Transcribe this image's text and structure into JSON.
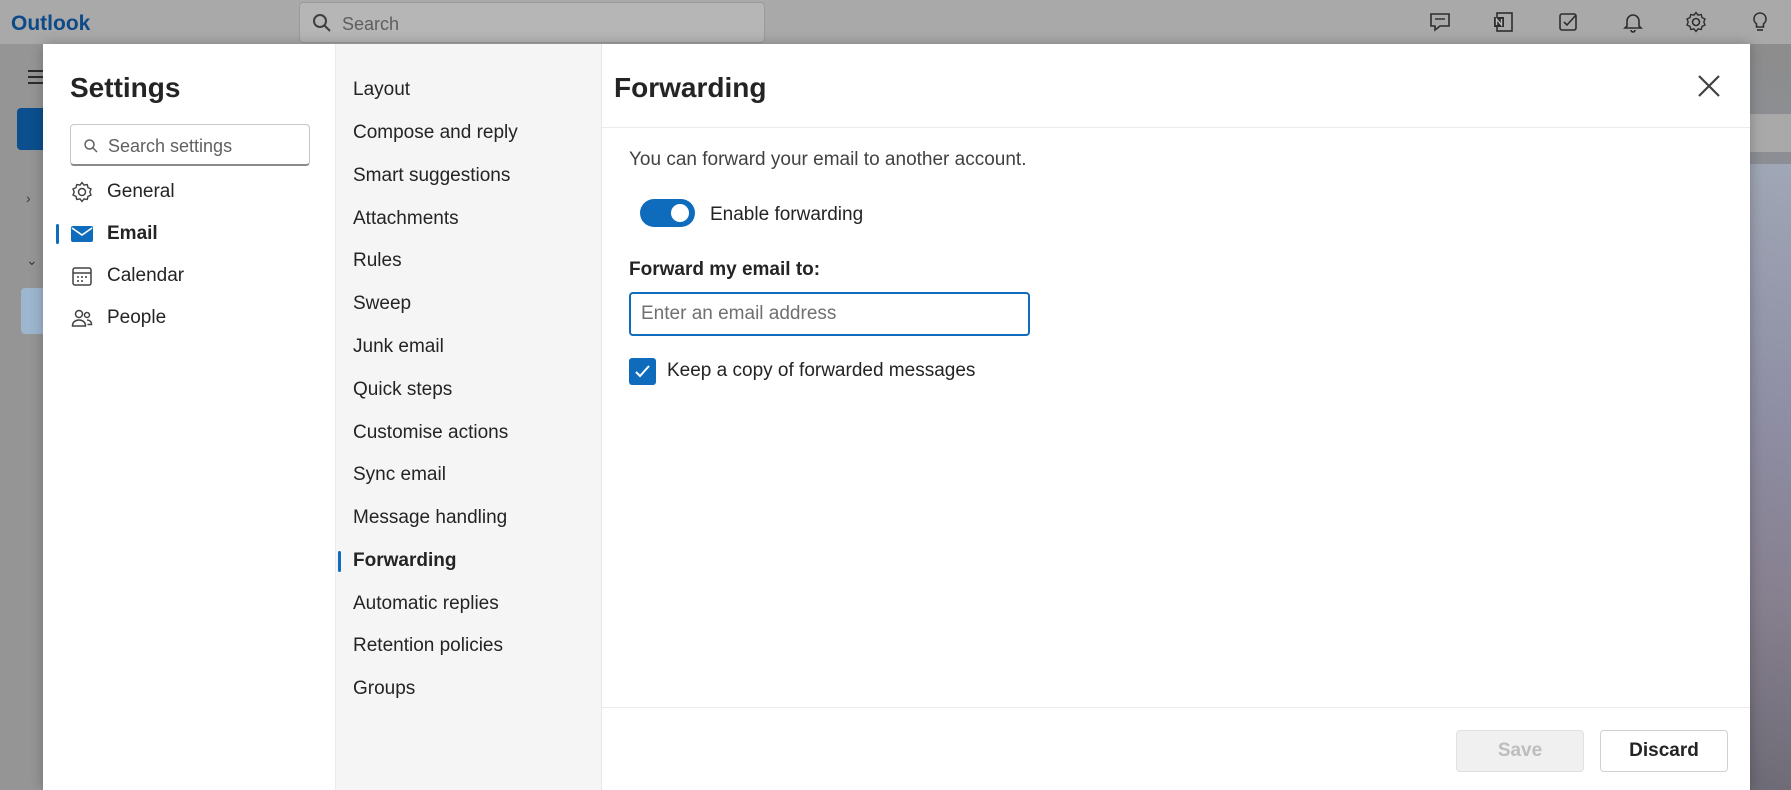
{
  "app": {
    "brand": "Outlook",
    "search_placeholder": "Search"
  },
  "topbar_icons": [
    "chat-icon",
    "onenote-icon",
    "todo-icon",
    "bell-icon",
    "gear-icon",
    "lightbulb-icon"
  ],
  "settings": {
    "title": "Settings",
    "search_placeholder": "Search settings",
    "categories": [
      {
        "label": "General",
        "icon": "gear-icon"
      },
      {
        "label": "Email",
        "icon": "mail-icon",
        "active": true
      },
      {
        "label": "Calendar",
        "icon": "calendar-icon"
      },
      {
        "label": "People",
        "icon": "people-icon"
      }
    ],
    "email_sections": [
      "Layout",
      "Compose and reply",
      "Smart suggestions",
      "Attachments",
      "Rules",
      "Sweep",
      "Junk email",
      "Quick steps",
      "Customise actions",
      "Sync email",
      "Message handling",
      "Forwarding",
      "Automatic replies",
      "Retention policies",
      "Groups"
    ],
    "active_section": "Forwarding"
  },
  "forwarding": {
    "title": "Forwarding",
    "description": "You can forward your email to another account.",
    "enable_label": "Enable forwarding",
    "enabled": true,
    "forward_to_label": "Forward my email to:",
    "email_placeholder": "Enter an email address",
    "email_value": "",
    "keep_copy_label": "Keep a copy of forwarded messages",
    "keep_copy": true
  },
  "buttons": {
    "save": "Save",
    "discard": "Discard"
  },
  "colors": {
    "accent": "#0f6cbd",
    "brand": "#0d4a87"
  }
}
